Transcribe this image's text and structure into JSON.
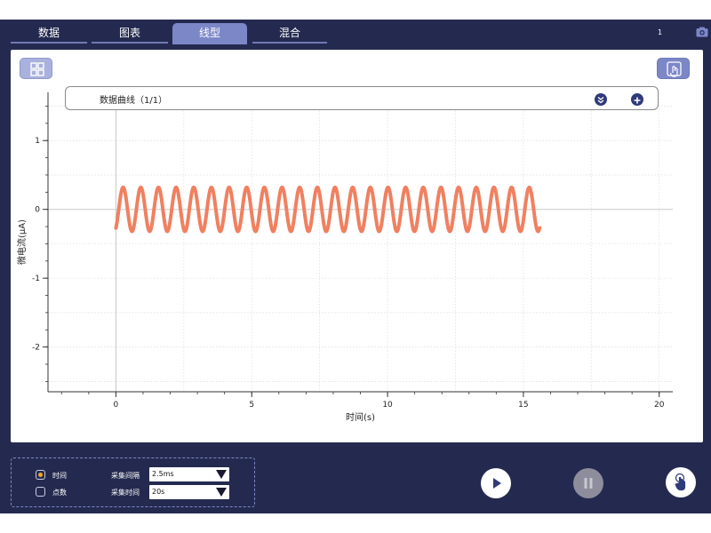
{
  "tabs": [
    {
      "label": "数据",
      "active": false
    },
    {
      "label": "图表",
      "active": false
    },
    {
      "label": "线型",
      "active": true
    },
    {
      "label": "混合",
      "active": false
    }
  ],
  "header": {
    "counter": "1",
    "camera_icon": "camera-icon"
  },
  "legend": {
    "label": "数据曲线（1/1）",
    "collapse_icon": "chevron-double-down-icon",
    "add_icon": "plus-icon"
  },
  "toolbar": {
    "layout_icon": "grid-layout-icon",
    "select_icon": "touch-select-icon"
  },
  "controls": {
    "mode_time": {
      "label": "时间",
      "checked": true
    },
    "mode_points": {
      "label": "点数",
      "checked": false
    },
    "interval": {
      "label": "采集间隔",
      "value": "2.5ms"
    },
    "duration": {
      "label": "采集时间",
      "value": "20s"
    }
  },
  "actions": {
    "play_icon": "play-icon",
    "pause_icon": "pause-icon",
    "touch_icon": "touch-icon"
  },
  "colors": {
    "background": "#242a4f",
    "accent": "#7c87c8",
    "series": "#f08060"
  },
  "chart_data": {
    "type": "line",
    "xlabel": "时间(s)",
    "ylabel": "微电流(μA)",
    "xlim": [
      -2.5,
      20.5
    ],
    "ylim": [
      -2.65,
      1.7
    ],
    "xticks": [
      0,
      5,
      10,
      15,
      20
    ],
    "yticks": [
      1,
      0,
      -1,
      -2
    ],
    "grid": true,
    "series": [
      {
        "x_start": 0,
        "x_end": 15.6,
        "cycles": 24,
        "y_min": -0.32,
        "y_max": 0.32,
        "y_start": -0.27,
        "y_end": -0.3
      }
    ]
  }
}
